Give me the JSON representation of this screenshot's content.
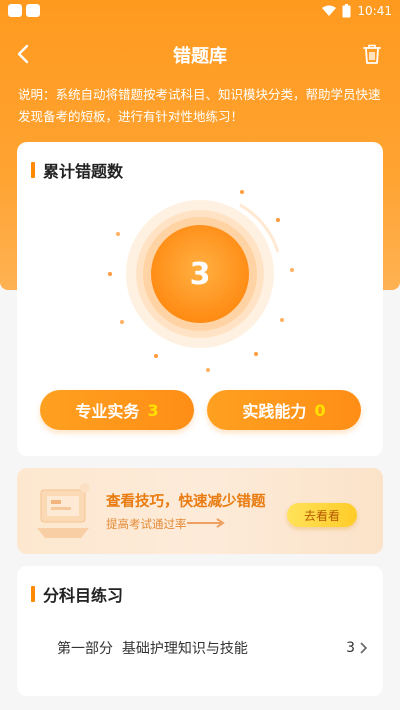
{
  "status_bar": {
    "time": "10:41"
  },
  "header": {
    "title": "错题库"
  },
  "description": "说明：系统自动将错题按考试科目、知识模块分类，帮助学员快速发现备考的短板，进行有针对性地练习！",
  "summary": {
    "section_title": "累计错题数",
    "total": "3",
    "categories": [
      {
        "label": "专业实务",
        "count": "3"
      },
      {
        "label": "实践能力",
        "count": "0"
      }
    ]
  },
  "banner": {
    "title": "查看技巧，快速减少错题",
    "subtitle": "提高考试通过率",
    "button_label": "去看看"
  },
  "practice": {
    "section_title": "分科目练习",
    "items": [
      {
        "label": "第一部分  基础护理知识与技能",
        "count": "3"
      }
    ]
  },
  "colors": {
    "accent": "#ff9a1f",
    "highlight": "#ffe000"
  }
}
